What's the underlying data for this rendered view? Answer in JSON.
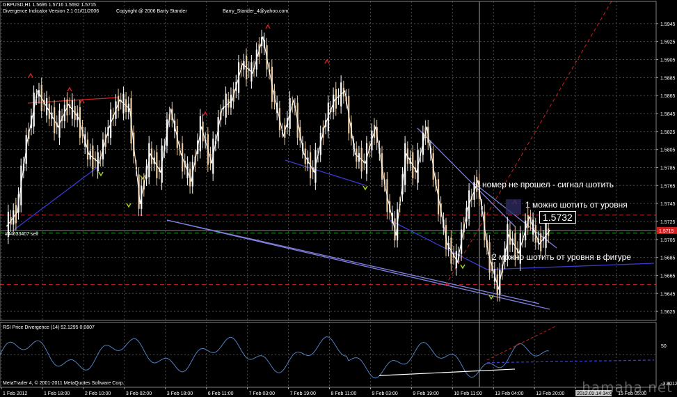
{
  "header": {
    "symbol_line": "GBPUSD,H1  1.5695 1.5716 1.5692 1.5715",
    "indicator_line": "Divergence Indicator Version 2.1  01/01/2006",
    "copyright": "Copyright @ 2006 Barry Stander",
    "email": "Barry_Stander_4@yahoo.com"
  },
  "annotations": {
    "top_signal": "номер не прошел - сигнал шотить",
    "level_one": "1 можно шотить от уровня",
    "level_box": "1.5732",
    "level_two": "2 можно шотить от уровня в фигуре",
    "order_label": "#44633407 sell"
  },
  "indicator_panel": {
    "title": "RSI Price Divergence (14) 52.1295 0.0807",
    "level_50": "50",
    "footer": "MetaTrader 4, © 2001-2011 MetaQuotes Software Corp.",
    "low_label": "-3.8012"
  },
  "watermark": "hamaha.net",
  "colors": {
    "background": "#000000",
    "grid": "#4a4a4a",
    "price_line": "#ffffff",
    "candle_up": "#ffffff",
    "candle_down": "#e8c9a0",
    "trend_blue": "#3a3ad0",
    "trend_violet": "#8080e0",
    "level_red": "#d02020",
    "level_green": "#20a020",
    "current_price_tag": "#d02020"
  },
  "chart_data": {
    "type": "line",
    "title": "GBPUSD,H1",
    "ylim": [
      1.5615,
      1.5965
    ],
    "price_ticks": [
      "1.5945",
      "1.5925",
      "1.5905",
      "1.5885",
      "1.5865",
      "1.5845",
      "1.5825",
      "1.5805",
      "1.5785",
      "1.5765",
      "1.5745",
      "1.5725",
      "1.5705",
      "1.5685",
      "1.5665",
      "1.5645",
      "1.5625"
    ],
    "current_price": "1.5715",
    "x_labels": [
      "1 Feb 2012",
      "1 Feb 18:00",
      "2 Feb 10:00",
      "3 Feb 02:00",
      "3 Feb 18:00",
      "6 Feb 11:00",
      "7 Feb 03:00",
      "7 Feb 19:00",
      "8 Feb 11:00",
      "9 Feb 03:00",
      "9 Feb 19:00",
      "10 Feb 11:00",
      "13 Feb 04:00",
      "13 Feb 20:00",
      "2012.02.14 14:00",
      "15 Feb 05:00"
    ],
    "x_cursor_label": "2012.02.14 14:00",
    "series": [
      {
        "name": "",
        "values": [
          1.572,
          1.5735,
          1.5815,
          1.587,
          1.585,
          1.583,
          1.5855,
          1.584,
          1.58,
          1.579,
          1.583,
          1.586,
          1.585,
          1.5745,
          1.58,
          1.578,
          1.585,
          1.58,
          1.577,
          1.583,
          1.579,
          1.585,
          1.586,
          1.59,
          1.589,
          1.593,
          1.587,
          1.582,
          1.586,
          1.58,
          1.578,
          1.583,
          1.586,
          1.587,
          1.58,
          1.579,
          1.583,
          1.576,
          1.571,
          1.58,
          1.578,
          1.583,
          1.576,
          1.57,
          1.568,
          1.574,
          1.577,
          1.569,
          1.565,
          1.571,
          1.569,
          1.573,
          1.57,
          1.5715
        ]
      }
    ],
    "levels": [
      1.5732,
      1.5712,
      1.5655
    ]
  }
}
